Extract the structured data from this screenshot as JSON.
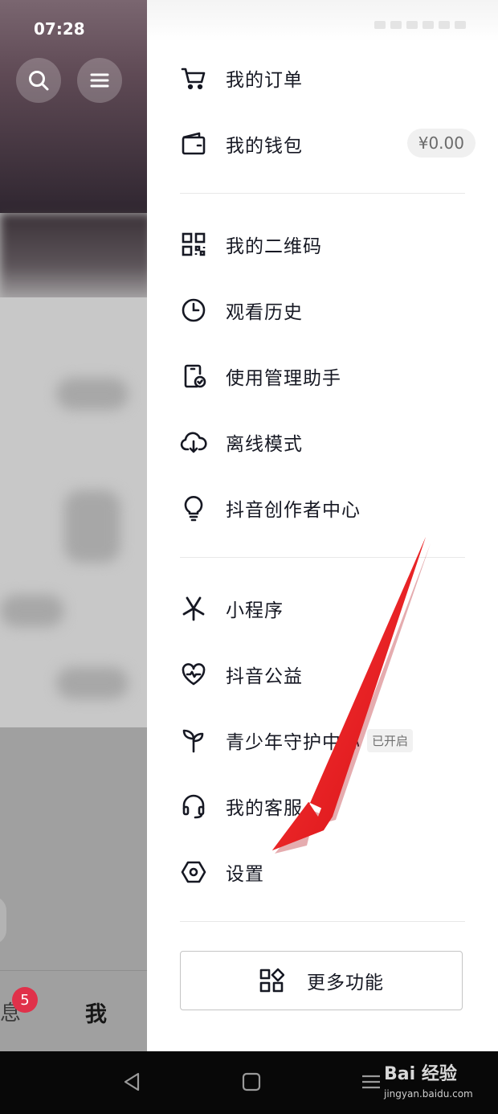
{
  "status_bar": {
    "time": "07:28"
  },
  "background_app": {
    "tabbar": {
      "messages_label": "息",
      "messages_badge": "5",
      "me_label": "我"
    }
  },
  "drawer": {
    "items": [
      {
        "id": "orders",
        "label": "我的订单",
        "icon": "cart-icon"
      },
      {
        "id": "wallet",
        "label": "我的钱包",
        "icon": "wallet-icon",
        "value": "¥0.00"
      },
      {
        "id": "qrcode",
        "label": "我的二维码",
        "icon": "qrcode-icon"
      },
      {
        "id": "history",
        "label": "观看历史",
        "icon": "clock-icon"
      },
      {
        "id": "usage",
        "label": "使用管理助手",
        "icon": "phone-check-icon"
      },
      {
        "id": "offline",
        "label": "离线模式",
        "icon": "cloud-download-icon"
      },
      {
        "id": "creator",
        "label": "抖音创作者中心",
        "icon": "lightbulb-icon"
      },
      {
        "id": "miniapp",
        "label": "小程序",
        "icon": "asterisk-icon"
      },
      {
        "id": "charity",
        "label": "抖音公益",
        "icon": "heart-icon"
      },
      {
        "id": "youth",
        "label": "青少年守护中心",
        "icon": "sprout-icon",
        "tag": "已开启"
      },
      {
        "id": "service",
        "label": "我的客服",
        "icon": "headset-icon"
      },
      {
        "id": "settings",
        "label": "设置",
        "icon": "hexagon-settings-icon"
      }
    ],
    "more_button": {
      "label": "更多功能",
      "icon": "grid-icon"
    }
  },
  "watermark": {
    "brand": "Bai 经验",
    "url": "jingyan.baidu.com"
  },
  "colors": {
    "arrow": "#e8141b",
    "badge": "#e0314a",
    "text": "#161823"
  }
}
